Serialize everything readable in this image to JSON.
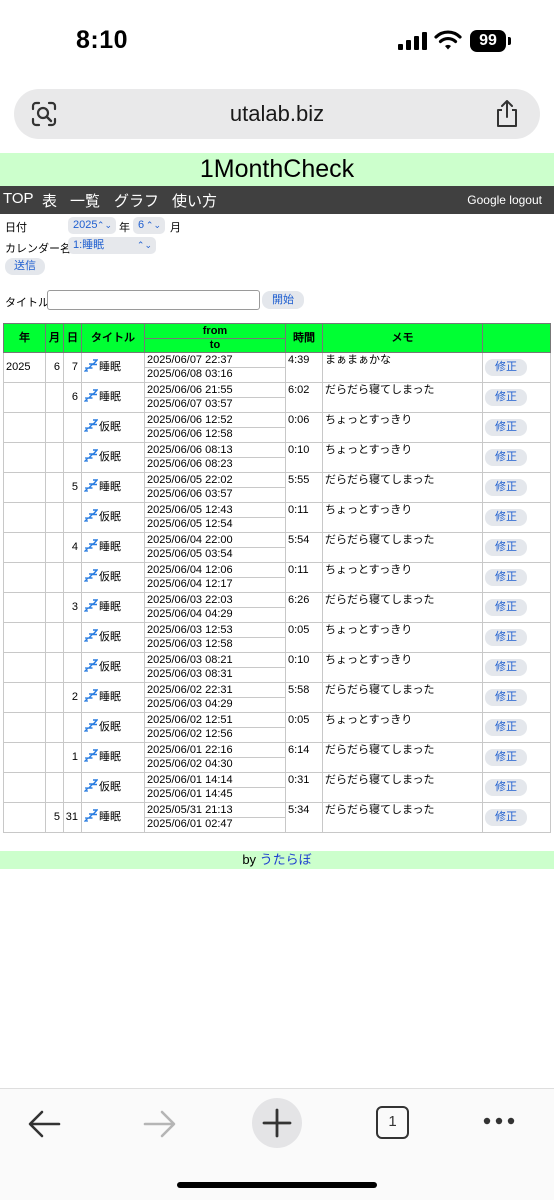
{
  "status_bar": {
    "time": "8:10",
    "battery": "99"
  },
  "browser": {
    "url": "utalab.biz"
  },
  "page": {
    "title": "1MonthCheck",
    "nav": [
      "TOP",
      "表",
      "一覧",
      "グラフ",
      "使い方"
    ],
    "logout": "Google logout",
    "form": {
      "date_label": "日付",
      "year_value": "2025",
      "year_unit": "年",
      "month_value": "6",
      "month_unit": "月",
      "calendar_label": "カレンダー名",
      "calendar_value": "1:睡眠",
      "submit": "送信",
      "title_label": "タイトル",
      "title_value": "",
      "start": "開始"
    },
    "table": {
      "headers": {
        "year": "年",
        "month": "月",
        "day": "日",
        "title": "タイトル",
        "from": "from",
        "to": "to",
        "duration": "時間",
        "memo": "メモ"
      },
      "edit_label": "修正",
      "rows": [
        {
          "year": "2025",
          "month": "6",
          "day": "7",
          "title": "睡眠",
          "from": "2025/06/07 22:37",
          "to": "2025/06/08 03:16",
          "duration": "4:39",
          "memo": "まぁまぁかな"
        },
        {
          "year": "",
          "month": "",
          "day": "6",
          "title": "睡眠",
          "from": "2025/06/06 21:55",
          "to": "2025/06/07 03:57",
          "duration": "6:02",
          "memo": "だらだら寝てしまった"
        },
        {
          "year": "",
          "month": "",
          "day": "",
          "title": "仮眠",
          "from": "2025/06/06 12:52",
          "to": "2025/06/06 12:58",
          "duration": "0:06",
          "memo": "ちょっとすっきり"
        },
        {
          "year": "",
          "month": "",
          "day": "",
          "title": "仮眠",
          "from": "2025/06/06 08:13",
          "to": "2025/06/06 08:23",
          "duration": "0:10",
          "memo": "ちょっとすっきり"
        },
        {
          "year": "",
          "month": "",
          "day": "5",
          "title": "睡眠",
          "from": "2025/06/05 22:02",
          "to": "2025/06/06 03:57",
          "duration": "5:55",
          "memo": "だらだら寝てしまった"
        },
        {
          "year": "",
          "month": "",
          "day": "",
          "title": "仮眠",
          "from": "2025/06/05 12:43",
          "to": "2025/06/05 12:54",
          "duration": "0:11",
          "memo": "ちょっとすっきり"
        },
        {
          "year": "",
          "month": "",
          "day": "4",
          "title": "睡眠",
          "from": "2025/06/04 22:00",
          "to": "2025/06/05 03:54",
          "duration": "5:54",
          "memo": "だらだら寝てしまった"
        },
        {
          "year": "",
          "month": "",
          "day": "",
          "title": "仮眠",
          "from": "2025/06/04 12:06",
          "to": "2025/06/04 12:17",
          "duration": "0:11",
          "memo": "ちょっとすっきり"
        },
        {
          "year": "",
          "month": "",
          "day": "3",
          "title": "睡眠",
          "from": "2025/06/03 22:03",
          "to": "2025/06/04 04:29",
          "duration": "6:26",
          "memo": "だらだら寝てしまった"
        },
        {
          "year": "",
          "month": "",
          "day": "",
          "title": "仮眠",
          "from": "2025/06/03 12:53",
          "to": "2025/06/03 12:58",
          "duration": "0:05",
          "memo": "ちょっとすっきり"
        },
        {
          "year": "",
          "month": "",
          "day": "",
          "title": "仮眠",
          "from": "2025/06/03 08:21",
          "to": "2025/06/03 08:31",
          "duration": "0:10",
          "memo": "ちょっとすっきり"
        },
        {
          "year": "",
          "month": "",
          "day": "2",
          "title": "睡眠",
          "from": "2025/06/02 22:31",
          "to": "2025/06/03 04:29",
          "duration": "5:58",
          "memo": "だらだら寝てしまった"
        },
        {
          "year": "",
          "month": "",
          "day": "",
          "title": "仮眠",
          "from": "2025/06/02 12:51",
          "to": "2025/06/02 12:56",
          "duration": "0:05",
          "memo": "ちょっとすっきり"
        },
        {
          "year": "",
          "month": "",
          "day": "1",
          "title": "睡眠",
          "from": "2025/06/01 22:16",
          "to": "2025/06/02 04:30",
          "duration": "6:14",
          "memo": "だらだら寝てしまった"
        },
        {
          "year": "",
          "month": "",
          "day": "",
          "title": "仮眠",
          "from": "2025/06/01 14:14",
          "to": "2025/06/01 14:45",
          "duration": "0:31",
          "memo": "だらだら寝てしまった"
        },
        {
          "year": "",
          "month": "5",
          "day": "31",
          "title": "睡眠",
          "from": "2025/05/31 21:13",
          "to": "2025/06/01 02:47",
          "duration": "5:34",
          "memo": "だらだら寝てしまった"
        }
      ]
    },
    "footer": {
      "by": "by",
      "link": "うたらぼ"
    }
  },
  "toolbar": {
    "tab_count": "1"
  },
  "icons": {
    "signal": "cellular-signal-icon",
    "wifi": "wifi-icon",
    "lens": "visual-lookup-icon",
    "share": "share-icon",
    "back": "back-arrow-icon",
    "forward": "forward-arrow-icon",
    "new_tab": "plus-icon",
    "tabs": "tab-switcher-icon",
    "more": "more-icon",
    "sleep": "zzz-icon"
  },
  "colors": {
    "title_band": "#ccffcc",
    "navbar": "#404040",
    "table_header": "#00ff33",
    "link": "#1f5fd0"
  }
}
